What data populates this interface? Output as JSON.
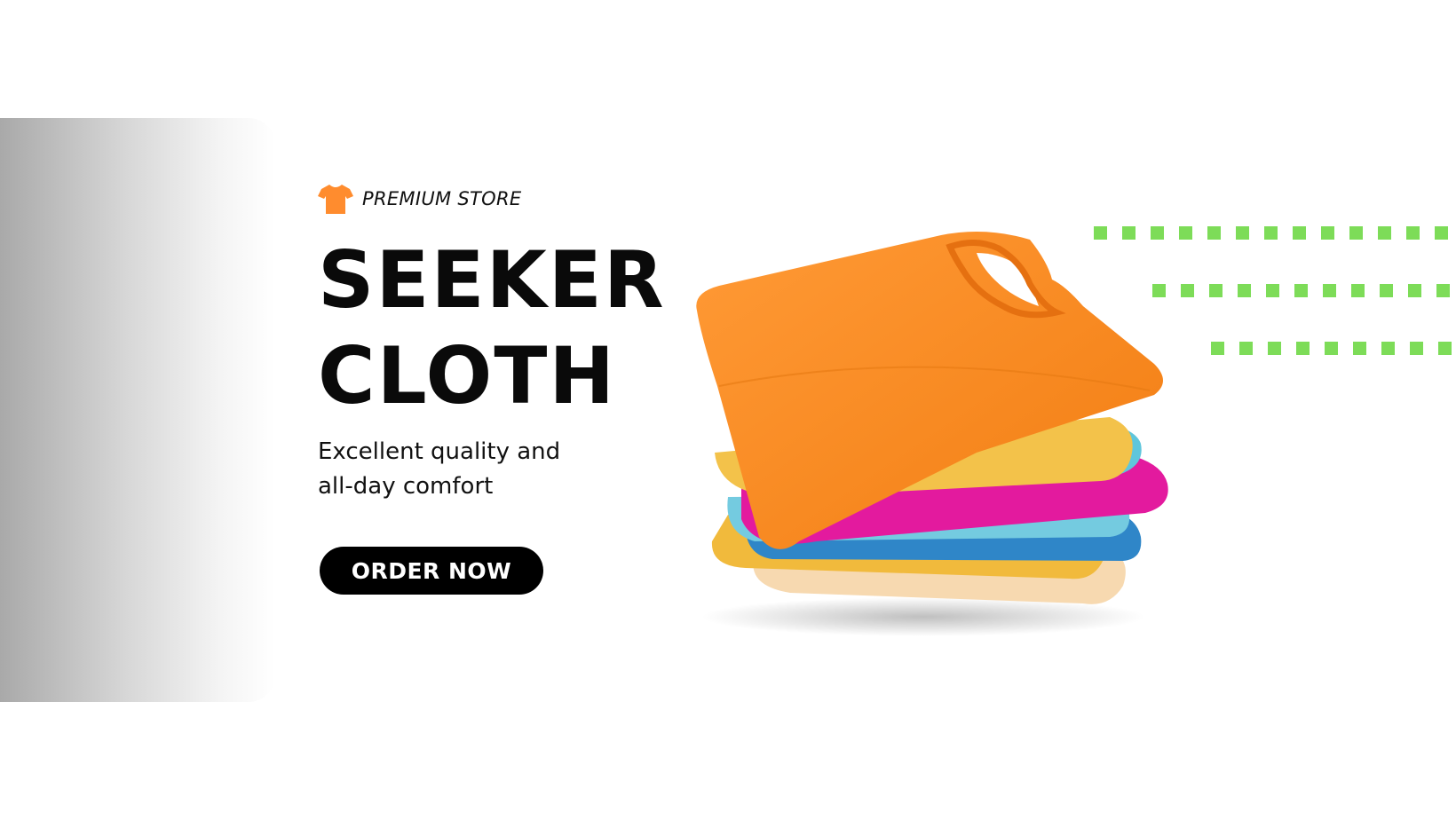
{
  "brand": {
    "label": "PREMIUM STORE",
    "icon": "t-shirt-icon",
    "icon_color": "#ff8c2e"
  },
  "headline": {
    "line1": "SEEKER",
    "line2": "CLOTH"
  },
  "tagline": {
    "line1": "Excellent quality and",
    "line2": "all-day comfort"
  },
  "cta": {
    "label": "ORDER NOW"
  },
  "image": {
    "subject": "folded-t-shirt-stack",
    "colors": [
      "#ff8a24",
      "#f3bf45",
      "#6fc7db",
      "#e3199c",
      "#3e8fd0",
      "#f7d9b0"
    ]
  },
  "decor": {
    "dot_color": "#7ddc58"
  }
}
